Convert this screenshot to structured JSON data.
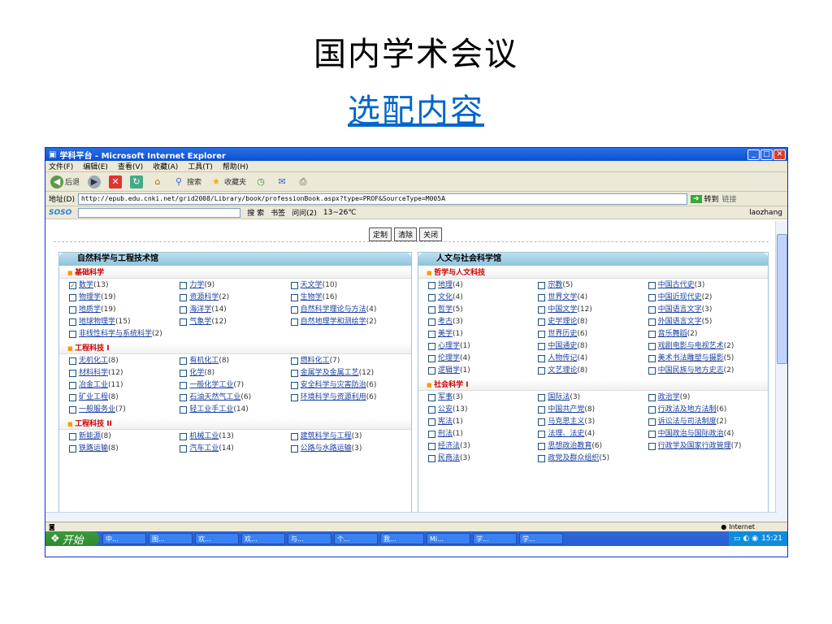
{
  "slide": {
    "title": "国内学术会议",
    "subtitle": "选配内容"
  },
  "window": {
    "title": "学科平台 - Microsoft Internet Explorer"
  },
  "menu": [
    "文件(F)",
    "编辑(E)",
    "查看(V)",
    "收藏(A)",
    "工具(T)",
    "帮助(H)"
  ],
  "toolbar": {
    "back": "后退",
    "search": "搜索",
    "favorites": "收藏夹"
  },
  "address": {
    "label": "地址(D)",
    "url": "http://epub.edu.cnki.net/grid2008/Library/book/professionBook.aspx?type=PROF&SourceType=M005A",
    "go": "转到",
    "links": "链接"
  },
  "soso": {
    "brand": "SOSO",
    "search": "搜 索",
    "bookmarks": "书签",
    "time": "问问(2)",
    "weather": "13~26℃",
    "user": "laozhang"
  },
  "buttons": {
    "customize": "定制",
    "clear": "清除",
    "close": "关闭"
  },
  "left_panel": {
    "title": "自然科学与工程技术馆",
    "sections": [
      {
        "name": "基础科学",
        "items": [
          {
            "label": "数学",
            "count": "(13)",
            "checked": true
          },
          {
            "label": "力学",
            "count": "(9)"
          },
          {
            "label": "天文学",
            "count": "(10)"
          },
          {
            "label": "物理学",
            "count": "(19)"
          },
          {
            "label": "资源科学",
            "count": "(2)"
          },
          {
            "label": "生物学",
            "count": "(16)"
          },
          {
            "label": "地质学",
            "count": "(19)"
          },
          {
            "label": "海洋学",
            "count": "(14)"
          },
          {
            "label": "自然科学理论与方法",
            "count": "(4)"
          },
          {
            "label": "地球物理学",
            "count": "(15)"
          },
          {
            "label": "气象学",
            "count": "(12)"
          },
          {
            "label": "自然地理学和测绘学",
            "count": "(2)"
          },
          {
            "label": "非线性科学与系统科学",
            "count": "(2)"
          }
        ]
      },
      {
        "name": "工程科技 I",
        "items": [
          {
            "label": "无机化工",
            "count": "(8)"
          },
          {
            "label": "有机化工",
            "count": "(8)"
          },
          {
            "label": "燃料化工",
            "count": "(7)"
          },
          {
            "label": "材料科学",
            "count": "(12)"
          },
          {
            "label": "化学",
            "count": "(8)"
          },
          {
            "label": "金属学及金属工艺",
            "count": "(12)"
          },
          {
            "label": "冶金工业",
            "count": "(11)"
          },
          {
            "label": "一般化学工业",
            "count": "(7)"
          },
          {
            "label": "安全科学与灾害防治",
            "count": "(6)"
          },
          {
            "label": "矿业工程",
            "count": "(8)"
          },
          {
            "label": "石油天然气工业",
            "count": "(6)"
          },
          {
            "label": "环境科学与资源利用",
            "count": "(6)"
          },
          {
            "label": "一般服务业",
            "count": "(7)"
          },
          {
            "label": "轻工业手工业",
            "count": "(14)"
          }
        ]
      },
      {
        "name": "工程科技 II",
        "items": [
          {
            "label": "新能源",
            "count": "(8)"
          },
          {
            "label": "机械工业",
            "count": "(13)"
          },
          {
            "label": "建筑科学与工程",
            "count": "(3)"
          },
          {
            "label": "铁路运输",
            "count": "(8)"
          },
          {
            "label": "汽车工业",
            "count": "(14)"
          },
          {
            "label": "公路与水路运输",
            "count": "(3)"
          }
        ]
      }
    ]
  },
  "right_panel": {
    "title": "人文与社会科学馆",
    "sections": [
      {
        "name": "哲学与人文科技",
        "items": [
          {
            "label": "地理",
            "count": "(4)"
          },
          {
            "label": "宗教",
            "count": "(5)"
          },
          {
            "label": "中国古代史",
            "count": "(3)"
          },
          {
            "label": "文化",
            "count": "(4)"
          },
          {
            "label": "世界文学",
            "count": "(4)"
          },
          {
            "label": "中国近现代史",
            "count": "(2)"
          },
          {
            "label": "哲学",
            "count": "(5)"
          },
          {
            "label": "中国文学",
            "count": "(12)"
          },
          {
            "label": "中国语言文字",
            "count": "(3)"
          },
          {
            "label": "考古",
            "count": "(3)"
          },
          {
            "label": "史学理论",
            "count": "(8)"
          },
          {
            "label": "外国语言文字",
            "count": "(5)"
          },
          {
            "label": "美学",
            "count": "(1)"
          },
          {
            "label": "世界历史",
            "count": "(6)"
          },
          {
            "label": "音乐舞蹈",
            "count": "(2)"
          },
          {
            "label": "心理学",
            "count": "(1)"
          },
          {
            "label": "中国通史",
            "count": "(8)"
          },
          {
            "label": "戏剧电影与电视艺术",
            "count": "(2)"
          },
          {
            "label": "伦理学",
            "count": "(4)"
          },
          {
            "label": "人物传记",
            "count": "(4)"
          },
          {
            "label": "美术书法雕塑与摄影",
            "count": "(5)"
          },
          {
            "label": "逻辑学",
            "count": "(1)"
          },
          {
            "label": "文艺理论",
            "count": "(8)"
          },
          {
            "label": "中国民族与地方史志",
            "count": "(2)"
          }
        ]
      },
      {
        "name": "社会科学 I",
        "items": [
          {
            "label": "军事",
            "count": "(3)"
          },
          {
            "label": "国际法",
            "count": "(3)"
          },
          {
            "label": "政治学",
            "count": "(9)"
          },
          {
            "label": "公安",
            "count": "(13)"
          },
          {
            "label": "中国共产党",
            "count": "(8)"
          },
          {
            "label": "行政法及地方法制",
            "count": "(6)"
          },
          {
            "label": "宪法",
            "count": "(1)"
          },
          {
            "label": "马克思主义",
            "count": "(3)"
          },
          {
            "label": "诉讼法与司法制度",
            "count": "(2)"
          },
          {
            "label": "刑法",
            "count": "(1)"
          },
          {
            "label": "法理、法史",
            "count": "(4)"
          },
          {
            "label": "中国政治与国际政治",
            "count": "(4)"
          },
          {
            "label": "经济法",
            "count": "(3)"
          },
          {
            "label": "思想政治教育",
            "count": "(6)"
          },
          {
            "label": "行政学及国家行政管理",
            "count": "(7)"
          },
          {
            "label": "民商法",
            "count": "(3)"
          },
          {
            "label": "政党及群众组织",
            "count": "(5)"
          }
        ]
      }
    ]
  },
  "status": {
    "zone": "Internet"
  },
  "taskbar": {
    "start": "开始",
    "tasks": [
      "中...",
      "图...",
      "欢...",
      "欢...",
      "与...",
      "个...",
      "我...",
      "Mi...",
      "学...",
      "学..."
    ],
    "clock": "15:21"
  }
}
